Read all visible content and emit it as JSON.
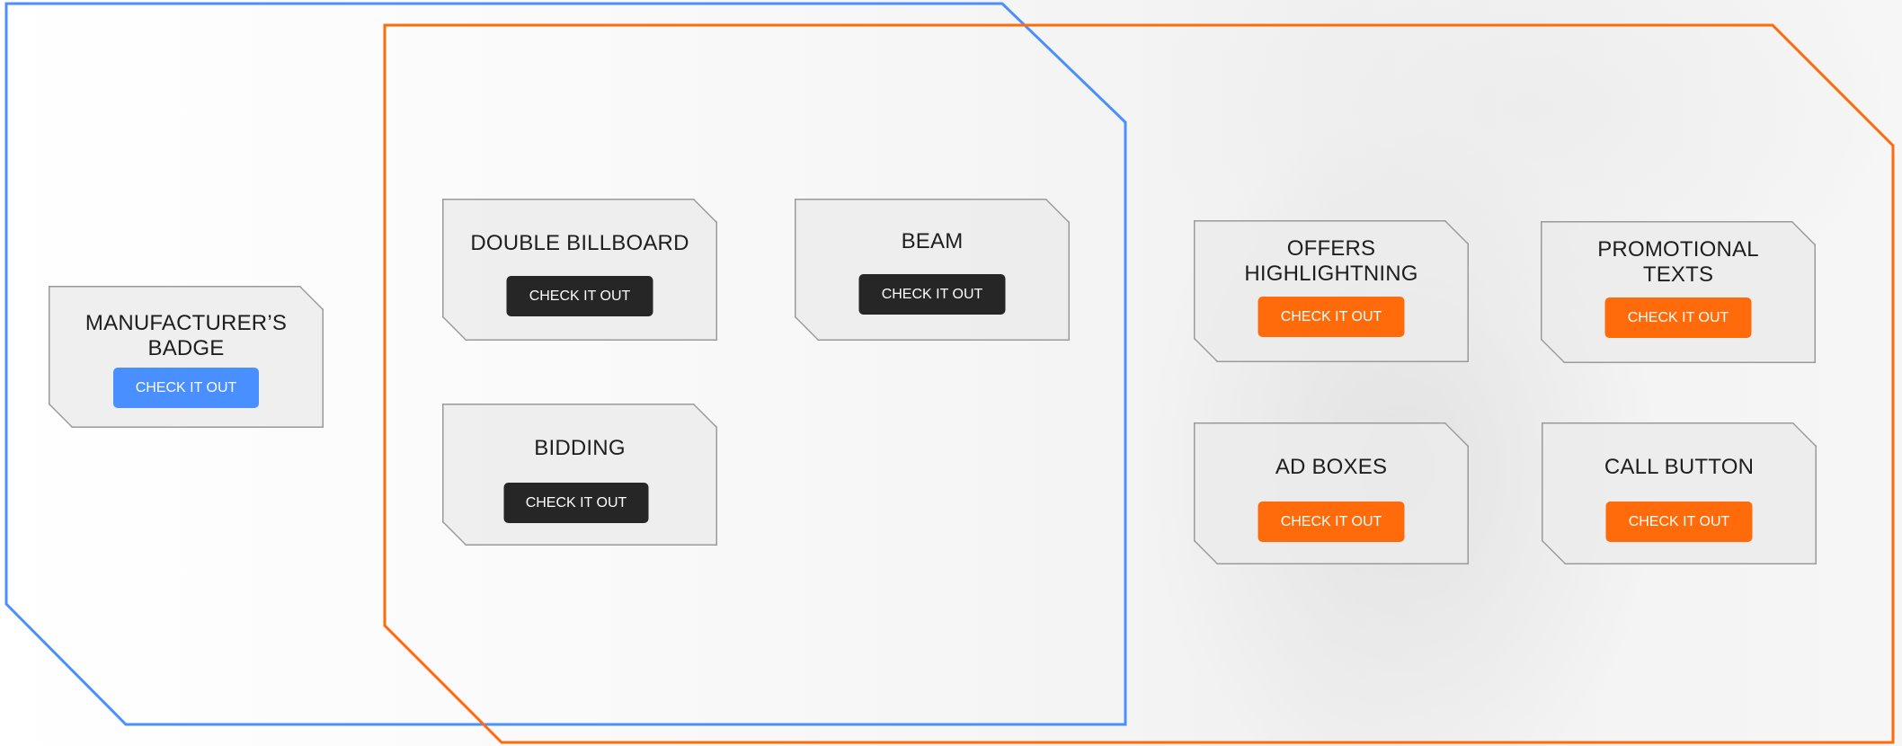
{
  "theme": {
    "blue": "#4a8fff",
    "orange": "#ff6a0a",
    "dark": "#262626"
  },
  "groups": {
    "blue_frame": {
      "color": "#4a8fff"
    },
    "orange_frame": {
      "color": "#ff6a0a"
    }
  },
  "cards": {
    "manufacturers_badge": {
      "title": "MANUFACTURER’S BADGE",
      "button_label": "CHECK IT OUT",
      "button_color": "blue"
    },
    "double_billboard": {
      "title": "DOUBLE BILLBOARD",
      "button_label": "CHECK IT OUT",
      "button_color": "dark"
    },
    "beam": {
      "title": "BEAM",
      "button_label": "CHECK IT OUT",
      "button_color": "dark"
    },
    "bidding": {
      "title": "BIDDING",
      "button_label": "CHECK IT OUT",
      "button_color": "dark"
    },
    "offers_highlightning": {
      "title": "OFFERS HIGHLIGHTNING",
      "button_label": "CHECK IT OUT",
      "button_color": "orange"
    },
    "promotional_texts": {
      "title": "PROMOTIONAL TEXTS",
      "button_label": "CHECK IT OUT",
      "button_color": "orange"
    },
    "ad_boxes": {
      "title": "AD BOXES",
      "button_label": "CHECK IT OUT",
      "button_color": "orange"
    },
    "call_button": {
      "title": "CALL BUTTON",
      "button_label": "CHECK IT OUT",
      "button_color": "orange"
    }
  }
}
